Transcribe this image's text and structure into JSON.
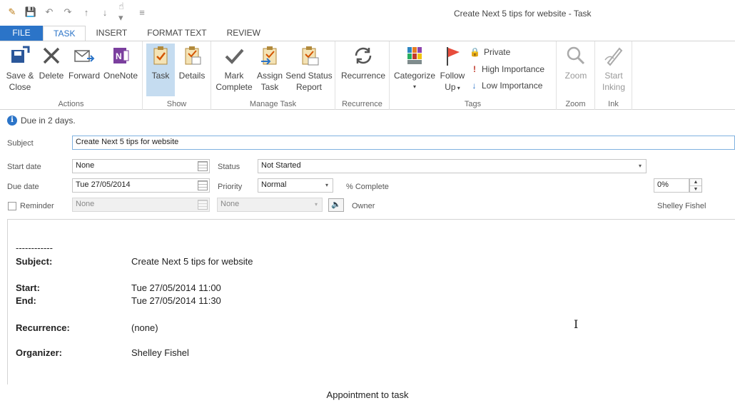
{
  "window": {
    "title": "Create Next 5 tips for website - Task"
  },
  "ribbon_tabs": [
    "FILE",
    "TASK",
    "INSERT",
    "FORMAT TEXT",
    "REVIEW"
  ],
  "groups": {
    "actions": {
      "label": "Actions",
      "save_close": [
        "Save &",
        "Close"
      ],
      "delete": "Delete",
      "forward": "Forward",
      "onenote": "OneNote"
    },
    "show": {
      "label": "Show",
      "task": "Task",
      "details": "Details"
    },
    "manage": {
      "label": "Manage Task",
      "mark_complete": [
        "Mark",
        "Complete"
      ],
      "assign_task": [
        "Assign",
        "Task"
      ],
      "send_status": [
        "Send Status",
        "Report"
      ]
    },
    "recurrence": {
      "label": "Recurrence",
      "recurrence": "Recurrence"
    },
    "tags": {
      "label": "Tags",
      "categorize": "Categorize",
      "follow_up": [
        "Follow",
        "Up"
      ],
      "private": "Private",
      "high": "High Importance",
      "low": "Low Importance"
    },
    "zoom": {
      "label": "Zoom",
      "zoom": "Zoom"
    },
    "ink": {
      "label": "Ink",
      "start_inking": [
        "Start",
        "Inking"
      ]
    }
  },
  "info": "Due in 2 days.",
  "form": {
    "subject_label": "Subject",
    "subject_value": "Create Next 5 tips for website",
    "start_label": "Start date",
    "start_value": "None",
    "due_label": "Due date",
    "due_value": "Tue 27/05/2014",
    "reminder_label": "Reminder",
    "reminder_date": "None",
    "reminder_time": "None",
    "status_label": "Status",
    "status_value": "Not Started",
    "priority_label": "Priority",
    "priority_value": "Normal",
    "complete_label": "% Complete",
    "complete_value": "0%",
    "owner_label": "Owner",
    "owner_value": "Shelley Fishel"
  },
  "body": {
    "separator": "------------",
    "subject_label": "Subject:",
    "subject_value": "Create Next 5 tips for website",
    "start_label": "Start:",
    "start_value": "Tue 27/05/2014 11:00",
    "end_label": "End:",
    "end_value": "Tue 27/05/2014 11:30",
    "recurrence_label": "Recurrence:",
    "recurrence_value": "(none)",
    "organizer_label": "Organizer:",
    "organizer_value": "Shelley Fishel"
  },
  "caption": "Appointment to task"
}
